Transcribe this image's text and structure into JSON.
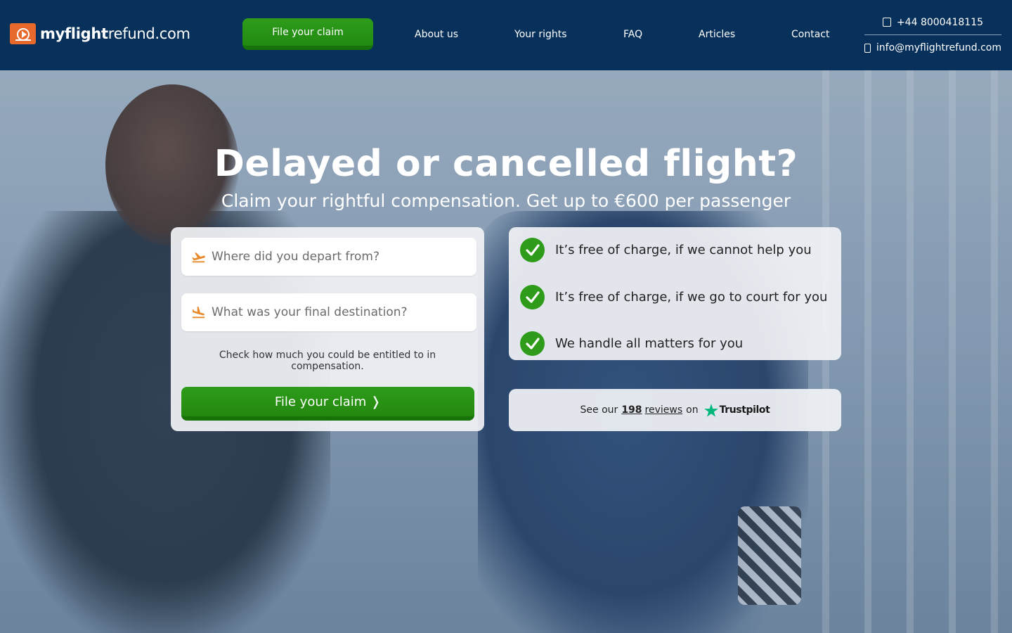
{
  "header": {
    "logo": {
      "bold": "myflight",
      "light": "refund.com"
    },
    "cta_label": "File your claim",
    "nav": [
      "About us",
      "Your rights",
      "FAQ",
      "Articles",
      "Contact"
    ],
    "phone": "+44 8000418115",
    "email": "info@myflightrefund.com"
  },
  "hero": {
    "title": "Delayed or cancelled flight?",
    "subtitle": "Claim your rightful compensation. Get up to €600 per passenger"
  },
  "form": {
    "departure_placeholder": "Where did you depart from?",
    "destination_placeholder": "What was your final destination?",
    "hint": "Check how much you could be entitled to in compensation.",
    "cta_label": "File your claim ❭"
  },
  "benefits": [
    "It’s free of charge, if we cannot help you",
    "It’s free of charge, if we go to court for you",
    "We handle all matters for you"
  ],
  "trustpilot": {
    "prefix": "See our",
    "count": "198",
    "reviews_word": "reviews",
    "suffix": "on",
    "brand": "Trustpilot"
  },
  "colors": {
    "header_bg": "#07305b",
    "cta_green": "#2e9c1a",
    "logo_orange": "#e8692c",
    "trustpilot_star": "#00b67a"
  },
  "icons": [
    "logo-mark-icon",
    "phone-icon",
    "email-icon",
    "takeoff-icon",
    "landing-icon",
    "check-icon",
    "trustpilot-star-icon"
  ]
}
